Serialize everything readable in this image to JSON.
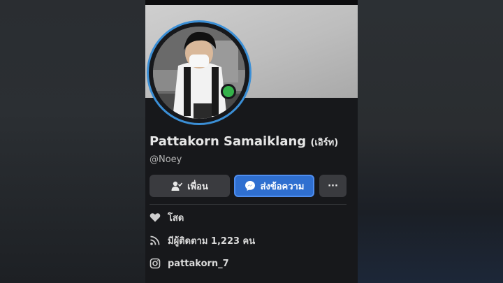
{
  "profile": {
    "name": "Pattakorn Samaiklang",
    "nickname": "(เอิร์ท)",
    "username": "@Noey",
    "online": true
  },
  "actions": {
    "friend_label": "เพื่อน",
    "message_label": "ส่งข้อความ",
    "more_label": "···"
  },
  "info": {
    "relationship": "โสด",
    "followers": "มีผู้ติดตาม 1,223 คน",
    "instagram": "pattakorn_7"
  },
  "colors": {
    "accent": "#2f6fd0",
    "online": "#35b24a",
    "avatar_ring": "#3b8fd6"
  }
}
